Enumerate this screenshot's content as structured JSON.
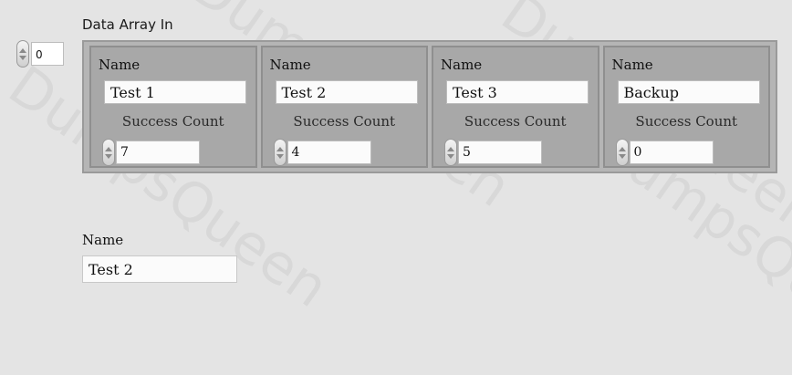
{
  "array": {
    "title": "Data Array In",
    "index": "0",
    "elements": [
      {
        "name_label": "Name",
        "name_value": "Test 1",
        "count_label": "Success Count",
        "count_value": "7"
      },
      {
        "name_label": "Name",
        "name_value": "Test 2",
        "count_label": "Success Count",
        "count_value": "4"
      },
      {
        "name_label": "Name",
        "name_value": "Test 3",
        "count_label": "Success Count",
        "count_value": "5"
      },
      {
        "name_label": "Name",
        "name_value": "Backup",
        "count_label": "Success Count",
        "count_value": "0"
      }
    ]
  },
  "output": {
    "label": "Name",
    "value": "Test 2"
  },
  "watermark": "DumpsQueen",
  "icons": {
    "array_index_spinner": "up-down-spinner-icon",
    "count_spinner": "up-down-spinner-icon"
  },
  "colors": {
    "panel_bg": "#e4e4e4",
    "array_frame": "#b5b5b5",
    "field_bg": "#fbfbfb"
  }
}
